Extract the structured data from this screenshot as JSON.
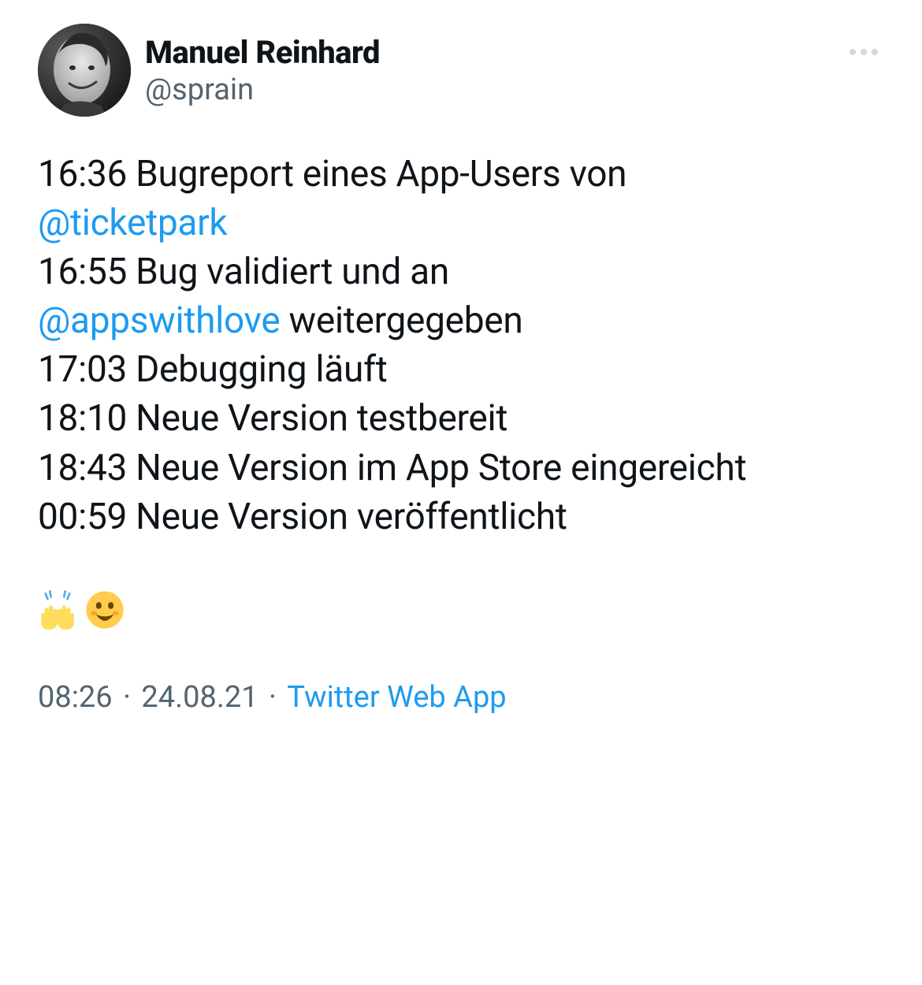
{
  "user": {
    "display_name": "Manuel Reinhard",
    "username": "@sprain"
  },
  "tweet": {
    "line1_prefix": "16:36 Bugreport eines App-Users von",
    "mention1": "@ticketpark",
    "line2_prefix": "16:55 Bug validiert und an",
    "mention2": "@appswithlove",
    "line2_suffix": "  weitergegeben",
    "line3": "17:03 Debugging läuft",
    "line4": "18:10 Neue Version testbereit",
    "line5": "18:43 Neue Version im App Store eingereicht",
    "line6": "00:59 Neue Version veröffentlicht",
    "emoji1_name": "raising-hands",
    "emoji2_name": "smiling-face"
  },
  "meta": {
    "time": "08:26",
    "date": "24.08.21",
    "source": "Twitter Web App",
    "separator": " · "
  },
  "colors": {
    "text": "#0f1419",
    "secondary": "#536471",
    "link": "#1d9bf0"
  }
}
